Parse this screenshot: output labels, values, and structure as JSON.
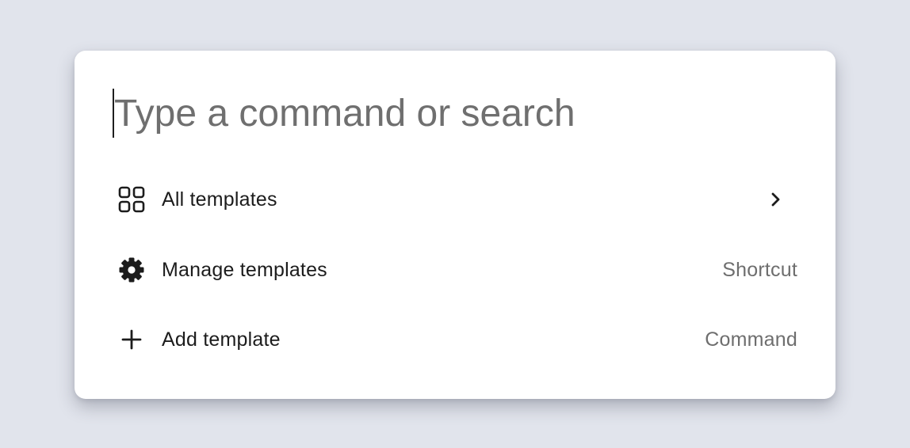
{
  "search": {
    "placeholder": "Type a command or search",
    "value": ""
  },
  "items": [
    {
      "label": "All templates",
      "icon": "grid-icon",
      "hint": "",
      "trailing_icon": "chevron-right-icon"
    },
    {
      "label": "Manage templates",
      "icon": "gear-icon",
      "hint": "Shortcut"
    },
    {
      "label": "Add template",
      "icon": "plus-icon",
      "hint": "Command"
    }
  ],
  "colors": {
    "background": "#e1e4ec",
    "panel": "#ffffff",
    "text": "#1c1c1c",
    "muted": "#6e6e6e"
  }
}
